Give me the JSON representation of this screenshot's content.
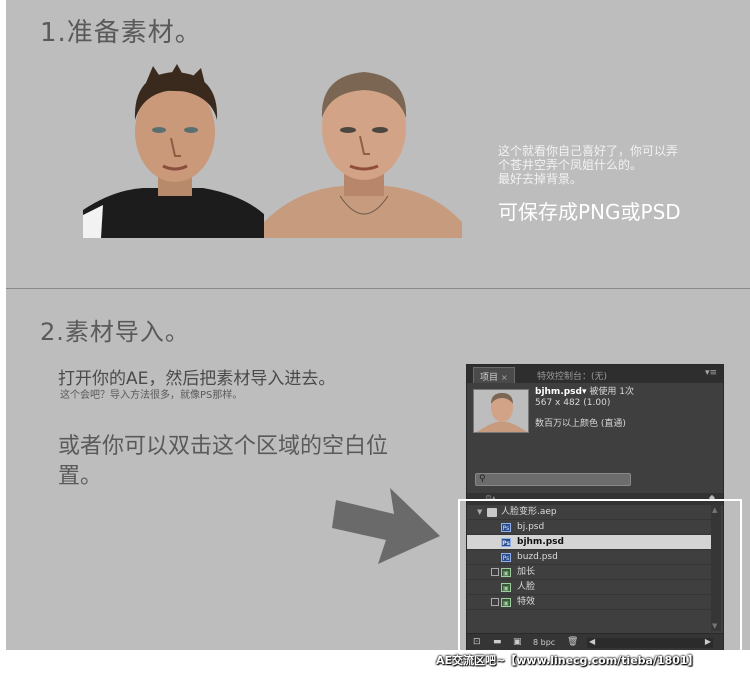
{
  "section1": {
    "title": "1.准备素材。",
    "note_lines": [
      "这个就看你自己喜好了，你可以弄",
      "个苍井空弄个凤姐什么的。",
      "最好去掉背景。"
    ],
    "note_big": "可保存成PNG或PSD"
  },
  "section2": {
    "title": "2.素材导入。",
    "line1": "打开你的AE，然后把素材导入进去。",
    "line2": "这个会吧？导入方法很多，就像PS那样。",
    "line3": "或者你可以双击这个区域的空白位置。"
  },
  "ae_panel": {
    "tab_project": "项目",
    "tab_effects": "特效控制台：(无)",
    "file_name": "bjhm.psd▾",
    "used_count": "被使用 1次",
    "dimensions": "567 x 482 (1.00)",
    "colors": "数百万以上颜色 (直通)",
    "items": [
      {
        "label": "人脸变形.aep",
        "type": "folder"
      },
      {
        "label": "bj.psd",
        "type": "psd"
      },
      {
        "label": "bjhm.psd",
        "type": "psd",
        "selected": true
      },
      {
        "label": "buzd.psd",
        "type": "psd"
      },
      {
        "label": "加长",
        "type": "comp-box"
      },
      {
        "label": "人脸",
        "type": "comp"
      },
      {
        "label": "特效",
        "type": "comp-box"
      }
    ],
    "bpc": "8 bpc"
  },
  "footer": "AE交流区吧~【www.linecg.com/tieba/1801】",
  "colors": {
    "background": "#bdbdbd",
    "panel": "#3f3f3f",
    "selected_row": "#d4d4d4",
    "highlight_box": "#ffffff"
  }
}
